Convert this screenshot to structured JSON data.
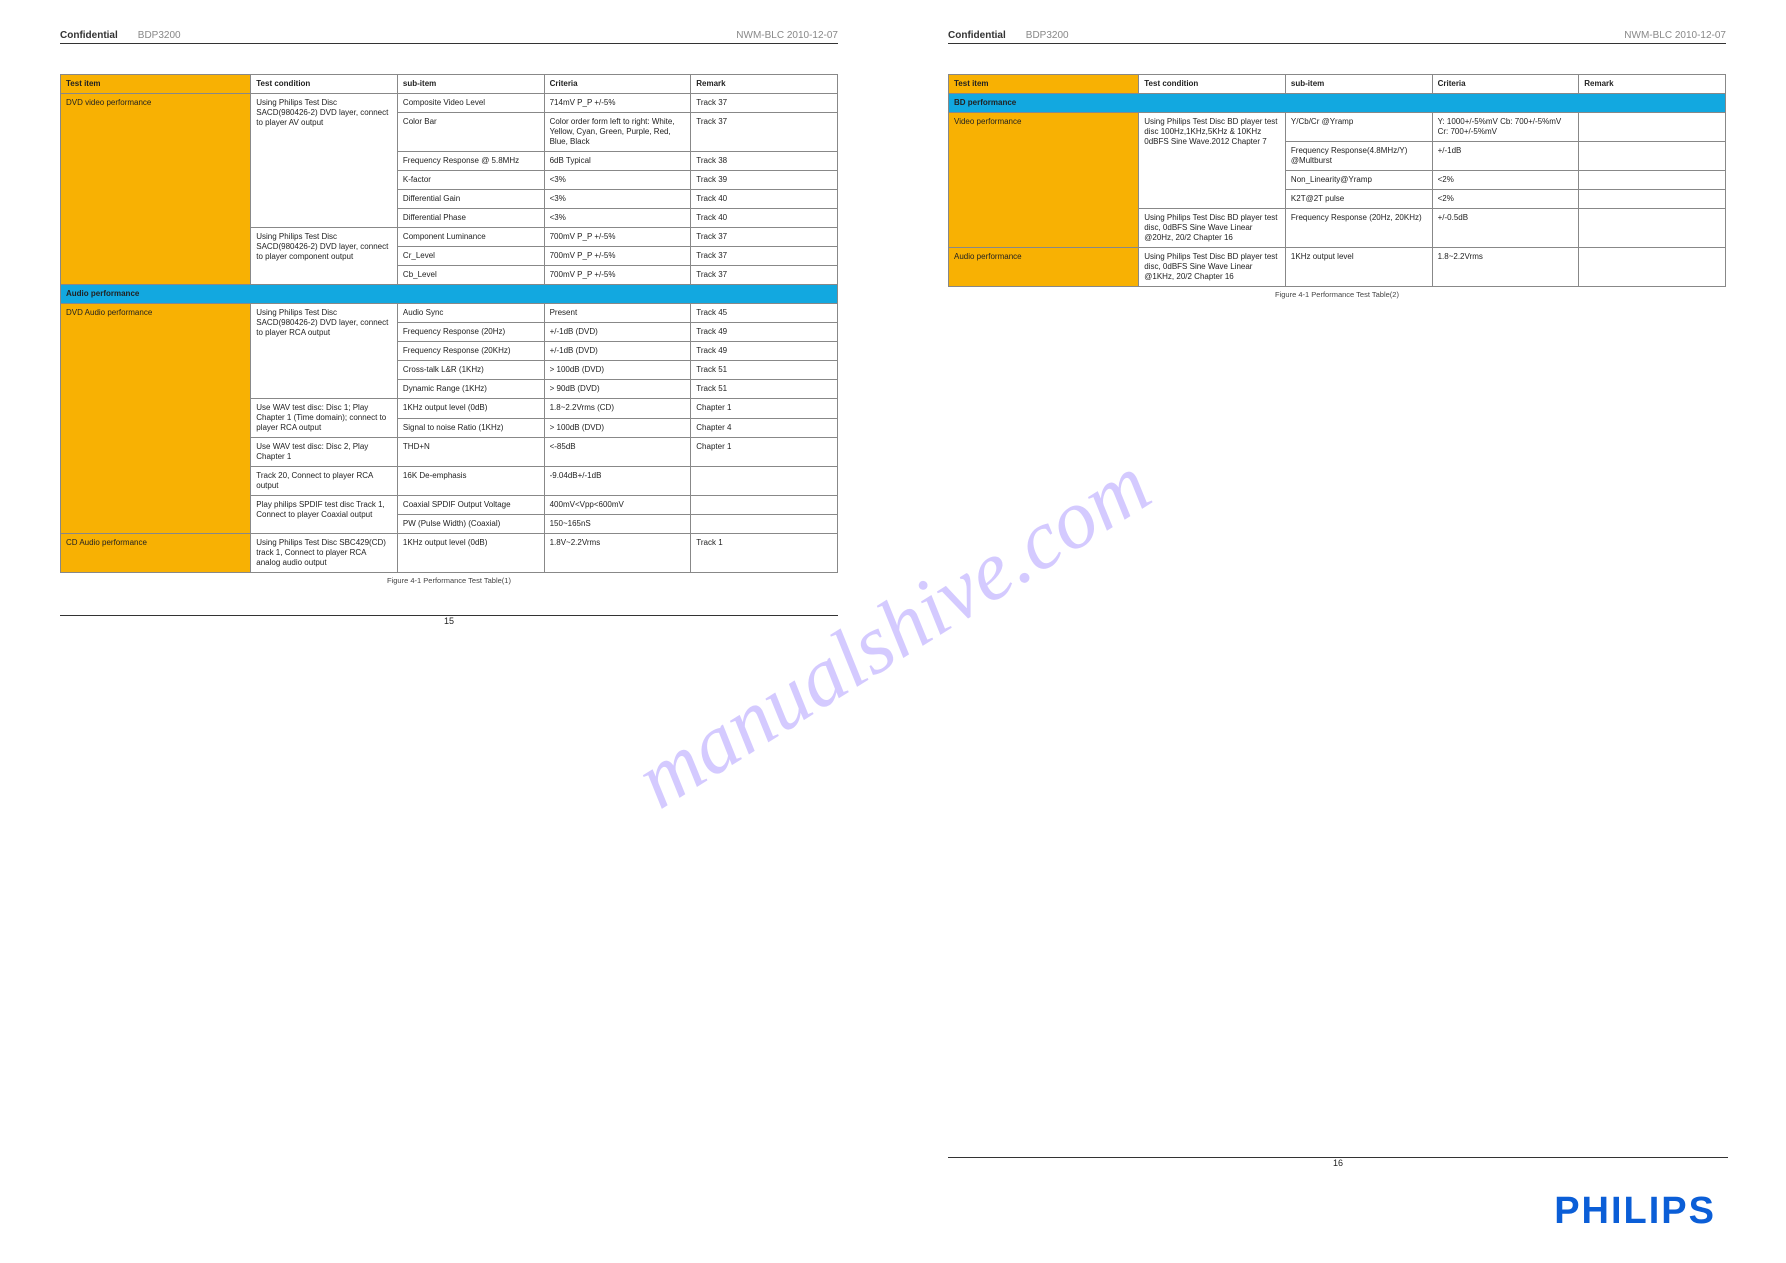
{
  "page_meta": {
    "company": "Confidential",
    "model": "BDP3200",
    "footer": "NWM-BLC 2010-12-07",
    "page_left": "15",
    "page_right": "16"
  },
  "left_table_header": [
    "Test item",
    "Test condition",
    "sub-item",
    "Criteria",
    "Remark"
  ],
  "left_rows_group1": [
    {
      "ti": "DVD video performance",
      "tc": "Using Philips Test Disc SACD(980426-2) DVD layer, connect to player AV output",
      "sub": "Composite Video Level",
      "crit": "714mV P_P +/-5%",
      "rem": "Track 37"
    },
    {
      "ti": "",
      "tc": "",
      "sub": "Color Bar",
      "crit": "Color order form left to right: White, Yellow, Cyan, Green, Purple, Red, Blue, Black",
      "rem": "Track 37"
    },
    {
      "ti": "",
      "tc": "",
      "sub": "Frequency Response @ 5.8MHz",
      "crit": "6dB Typical",
      "rem": "Track 38"
    },
    {
      "ti": "",
      "tc": "",
      "sub": "K-factor",
      "crit": "<3%",
      "rem": "Track 39"
    },
    {
      "ti": "",
      "tc": "",
      "sub": "Differential Gain",
      "crit": "<3%",
      "rem": "Track 40"
    },
    {
      "ti": "",
      "tc": "",
      "sub": "Differential Phase",
      "crit": "<3%",
      "rem": "Track 40"
    },
    {
      "ti": "",
      "tc": "Using Philips Test Disc SACD(980426-2) DVD layer, connect to player component output",
      "sub": "Component Luminance",
      "crit": "700mV P_P +/-5%",
      "rem": "Track 37"
    },
    {
      "ti": "",
      "tc": "",
      "sub": "Cr_Level",
      "crit": "700mV P_P +/-5%",
      "rem": "Track 37"
    },
    {
      "ti": "",
      "tc": "",
      "sub": "Cb_Level",
      "crit": "700mV P_P +/-5%",
      "rem": "Track 37"
    }
  ],
  "left_section_divider": "Audio performance",
  "left_rows_group2": [
    {
      "ti": "DVD Audio performance",
      "tc": "Using Philips Test Disc SACD(980426-2) DVD layer, connect to player RCA output",
      "sub": "Audio Sync",
      "crit": "Present",
      "rem": "Track 45"
    },
    {
      "ti": "",
      "tc": "",
      "sub": "Frequency Response (20Hz)",
      "crit": "+/-1dB (DVD)",
      "rem": "Track 49"
    },
    {
      "ti": "",
      "tc": "",
      "sub": "Frequency Response (20KHz)",
      "crit": "+/-1dB (DVD)",
      "rem": "Track 49"
    },
    {
      "ti": "",
      "tc": "",
      "sub": "Cross-talk L&R (1KHz)",
      "crit": "> 100dB (DVD)",
      "rem": "Track 51"
    },
    {
      "ti": "",
      "tc": "",
      "sub": "Dynamic Range (1KHz)",
      "crit": "> 90dB (DVD)",
      "rem": "Track 51"
    },
    {
      "ti": "",
      "tc": "Use WAV test disc: Disc 1; Play Chapter 1 (Time domain); connect to player RCA output",
      "sub": "1KHz output level (0dB)",
      "crit": "1.8~2.2Vrms (CD)",
      "rem": "Chapter 1"
    },
    {
      "ti": "",
      "tc": "",
      "sub": "Signal to noise Ratio (1KHz)",
      "crit": "> 100dB (DVD)",
      "rem": "Chapter 4"
    },
    {
      "ti": "",
      "tc": "Use WAV test disc: Disc 2, Play Chapter 1",
      "sub": "THD+N",
      "crit": "<-85dB",
      "rem": "Chapter 1"
    },
    {
      "ti": "",
      "tc": "Track 20, Connect to player RCA output",
      "sub": "16K De-emphasis",
      "crit": "-9.04dB+/-1dB",
      "rem": ""
    },
    {
      "ti": "",
      "tc": "Play philips SPDIF test disc Track 1, Connect to player Coaxial output",
      "sub": "Coaxial SPDIF Output Voltage",
      "crit": "400mV<Vpp<600mV",
      "rem": ""
    },
    {
      "ti": "",
      "tc": "",
      "sub": "PW (Pulse Width) (Coaxial)",
      "crit": "150~165nS",
      "rem": ""
    },
    {
      "ti": "CD Audio performance",
      "tc": "Using Philips Test Disc SBC429(CD) track 1, Connect to player RCA analog audio output",
      "sub": "1KHz output level (0dB)",
      "crit": "1.8V~2.2Vrms",
      "rem": "Track 1"
    }
  ],
  "left_caption": "Figure 4-1 Performance Test Table(1)",
  "right_table_header": [
    "Test item",
    "Test condition",
    "sub-item",
    "Criteria",
    "Remark"
  ],
  "right_section_divider": "BD performance",
  "right_rows": [
    {
      "ti": "Video performance",
      "tc": "Using Philips Test Disc BD player test disc 100Hz,1KHz,5KHz & 10KHz 0dBFS Sine Wave.2012 Chapter 7",
      "sub": "Y/Cb/Cr @Yramp",
      "crit": "Y: 1000+/-5%mV Cb: 700+/-5%mV Cr: 700+/-5%mV",
      "rem": ""
    },
    {
      "ti": "",
      "tc": "",
      "sub": "Frequency Response(4.8MHz/Y) @Multburst",
      "crit": "+/-1dB",
      "rem": ""
    },
    {
      "ti": "",
      "tc": "",
      "sub": "Non_Linearity@Yramp",
      "crit": "<2%",
      "rem": ""
    },
    {
      "ti": "",
      "tc": "",
      "sub": "K2T@2T pulse",
      "crit": "<2%",
      "rem": ""
    },
    {
      "ti": "",
      "tc": "Using Philips Test Disc BD player test disc, 0dBFS Sine Wave Linear @20Hz, 20/2 Chapter 16",
      "sub": "Frequency Response (20Hz, 20KHz)",
      "crit": "+/-0.5dB",
      "rem": ""
    },
    {
      "ti": "Audio performance",
      "tc": "Using Philips Test Disc BD player test disc, 0dBFS Sine Wave Linear @1KHz, 20/2 Chapter 16",
      "sub": "1KHz output level",
      "crit": "1.8~2.2Vrms",
      "rem": ""
    }
  ],
  "right_caption": "Figure 4-1 Performance Test Table(2)",
  "watermark": "manualshive.com",
  "logo": "PHILIPS"
}
